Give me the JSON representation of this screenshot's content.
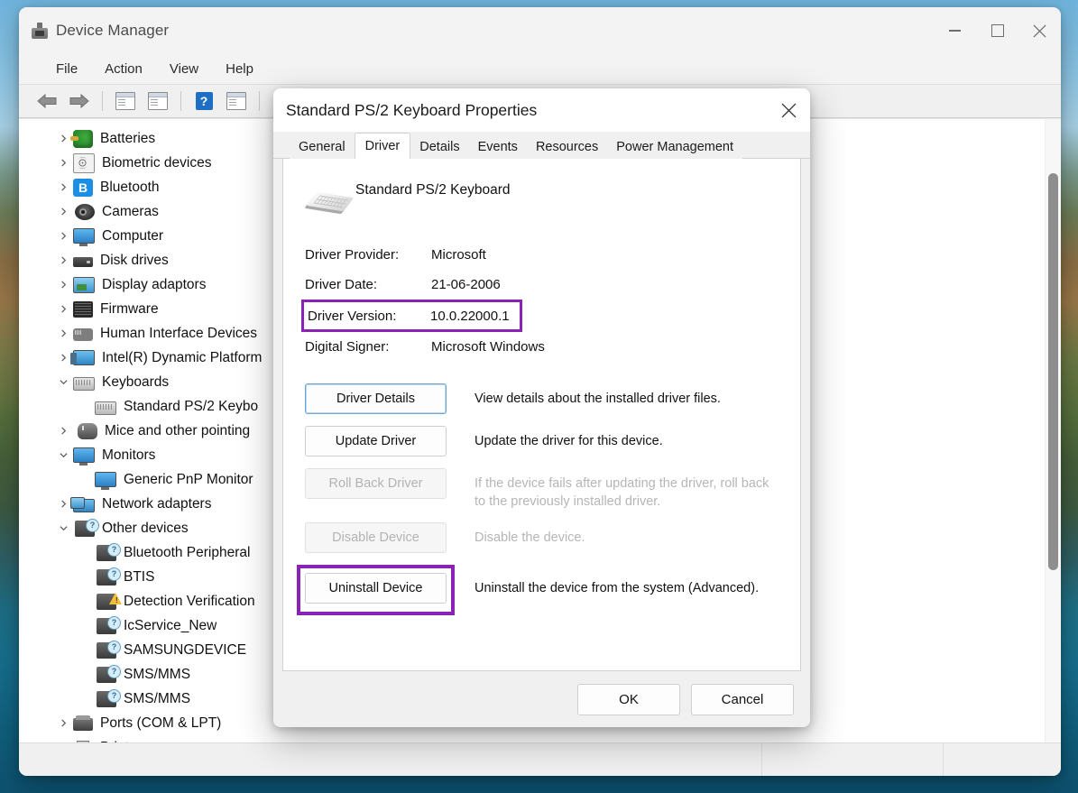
{
  "colors": {
    "highlight_purple": "#8a22b5",
    "accent_blue": "#1e6fc4",
    "window_bg": "#f3f3f3"
  },
  "window": {
    "title": "Device Manager",
    "icon": "device-manager-icon",
    "controls": {
      "minimize": "minimize-icon",
      "maximize": "maximize-icon",
      "close": "close-icon"
    },
    "menu": [
      "File",
      "Action",
      "View",
      "Help"
    ],
    "toolbar": [
      "back-arrow-icon",
      "forward-arrow-icon",
      "show-hide-console-tree-icon",
      "properties-icon",
      "help-icon",
      "scan-for-hardware-changes-icon",
      "update-driver-icon"
    ]
  },
  "tree": {
    "nodes": [
      {
        "label": "Batteries",
        "icon": "battery-icon",
        "level": 0,
        "state": "collapsed"
      },
      {
        "label": "Biometric devices",
        "icon": "fingerprint-icon",
        "level": 0,
        "state": "collapsed"
      },
      {
        "label": "Bluetooth",
        "icon": "bluetooth-icon",
        "level": 0,
        "state": "collapsed"
      },
      {
        "label": "Cameras",
        "icon": "camera-icon",
        "level": 0,
        "state": "collapsed"
      },
      {
        "label": "Computer",
        "icon": "computer-icon",
        "level": 0,
        "state": "collapsed"
      },
      {
        "label": "Disk drives",
        "icon": "disk-drive-icon",
        "level": 0,
        "state": "collapsed"
      },
      {
        "label": "Display adaptors",
        "icon": "display-adapter-icon",
        "level": 0,
        "state": "collapsed"
      },
      {
        "label": "Firmware",
        "icon": "firmware-icon",
        "level": 0,
        "state": "collapsed"
      },
      {
        "label": "Human Interface Devices",
        "icon": "hid-icon",
        "level": 0,
        "state": "collapsed"
      },
      {
        "label": "Intel(R) Dynamic Platform",
        "icon": "intel-platform-icon",
        "level": 0,
        "state": "collapsed"
      },
      {
        "label": "Keyboards",
        "icon": "keyboard-icon",
        "level": 0,
        "state": "expanded"
      },
      {
        "label": "Standard PS/2 Keybo",
        "icon": "keyboard-icon",
        "level": 1,
        "state": "leaf"
      },
      {
        "label": "Mice and other pointing",
        "icon": "mouse-icon",
        "level": 0,
        "state": "collapsed"
      },
      {
        "label": "Monitors",
        "icon": "monitor-icon",
        "level": 0,
        "state": "expanded"
      },
      {
        "label": "Generic PnP Monitor",
        "icon": "monitor-icon",
        "level": 1,
        "state": "leaf"
      },
      {
        "label": "Network adapters",
        "icon": "network-adapter-icon",
        "level": 0,
        "state": "collapsed"
      },
      {
        "label": "Other devices",
        "icon": "unknown-device-icon",
        "level": 0,
        "state": "expanded"
      },
      {
        "label": "Bluetooth Peripheral",
        "icon": "unknown-device-icon",
        "level": 1,
        "state": "leaf"
      },
      {
        "label": "BTIS",
        "icon": "unknown-device-icon",
        "level": 1,
        "state": "leaf"
      },
      {
        "label": "Detection Verification",
        "icon": "warning-device-icon",
        "level": 1,
        "state": "leaf"
      },
      {
        "label": "IcService_New",
        "icon": "unknown-device-icon",
        "level": 1,
        "state": "leaf"
      },
      {
        "label": "SAMSUNGDEVICE",
        "icon": "unknown-device-icon",
        "level": 1,
        "state": "leaf"
      },
      {
        "label": "SMS/MMS",
        "icon": "unknown-device-icon",
        "level": 1,
        "state": "leaf"
      },
      {
        "label": "SMS/MMS",
        "icon": "unknown-device-icon",
        "level": 1,
        "state": "leaf"
      },
      {
        "label": "Ports (COM & LPT)",
        "icon": "port-icon",
        "level": 0,
        "state": "collapsed"
      },
      {
        "label": "Print queues",
        "icon": "printer-icon",
        "level": 0,
        "state": "collapsed"
      }
    ]
  },
  "dialog": {
    "title": "Standard PS/2 Keyboard Properties",
    "close_icon": "close-icon",
    "tabs": [
      {
        "label": "General",
        "active": false
      },
      {
        "label": "Driver",
        "active": true
      },
      {
        "label": "Details",
        "active": false
      },
      {
        "label": "Events",
        "active": false
      },
      {
        "label": "Resources",
        "active": false
      },
      {
        "label": "Power Management",
        "active": false
      }
    ],
    "device_name": "Standard PS/2 Keyboard",
    "device_icon": "keyboard-icon",
    "info": [
      {
        "label": "Driver Provider:",
        "value": "Microsoft",
        "highlighted": false
      },
      {
        "label": "Driver Date:",
        "value": "21-06-2006",
        "highlighted": false
      },
      {
        "label": "Driver Version:",
        "value": "10.0.22000.1",
        "highlighted": true
      },
      {
        "label": "Digital Signer:",
        "value": "Microsoft Windows",
        "highlighted": false
      }
    ],
    "actions": [
      {
        "button": "Driver Details",
        "description": "View details about the installed driver files.",
        "disabled": false,
        "focused": true,
        "highlighted": false
      },
      {
        "button": "Update Driver",
        "description": "Update the driver for this device.",
        "disabled": false,
        "focused": false,
        "highlighted": false
      },
      {
        "button": "Roll Back Driver",
        "description": "If the device fails after updating the driver, roll back to the previously installed driver.",
        "disabled": true,
        "focused": false,
        "highlighted": false
      },
      {
        "button": "Disable Device",
        "description": "Disable the device.",
        "disabled": true,
        "focused": false,
        "highlighted": false
      },
      {
        "button": "Uninstall Device",
        "description": "Uninstall the device from the system (Advanced).",
        "disabled": false,
        "focused": false,
        "highlighted": true
      }
    ],
    "footer": {
      "ok": "OK",
      "cancel": "Cancel"
    }
  }
}
